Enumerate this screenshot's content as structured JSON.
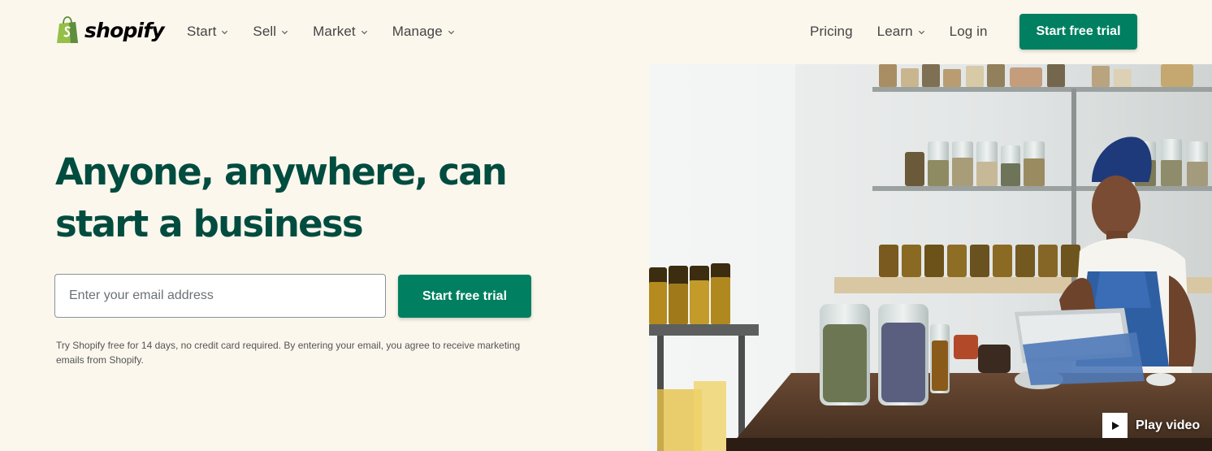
{
  "header": {
    "logo_text": "shopify",
    "nav_left": [
      {
        "label": "Start"
      },
      {
        "label": "Sell"
      },
      {
        "label": "Market"
      },
      {
        "label": "Manage"
      }
    ],
    "nav_right": {
      "pricing": "Pricing",
      "learn": "Learn",
      "login": "Log in"
    },
    "cta_label": "Start free trial"
  },
  "hero": {
    "headline_line1": "Anyone, anywhere, can",
    "headline_line2": "start a business",
    "email_placeholder": "Enter your email address",
    "email_value": "",
    "cta_label": "Start free trial",
    "disclaimer": "Try Shopify free for 14 days, no credit card required. By entering your email, you agree to receive marketing emails from Shopify.",
    "play_video_label": "Play video"
  },
  "colors": {
    "background": "#fbf7ed",
    "brand_green": "#008060",
    "headline_green": "#004c3f",
    "logo_green": "#95bf47"
  },
  "icons": {
    "logo": "shopping-bag-icon",
    "nav_dropdown": "chevron-down-icon",
    "play": "play-icon"
  }
}
